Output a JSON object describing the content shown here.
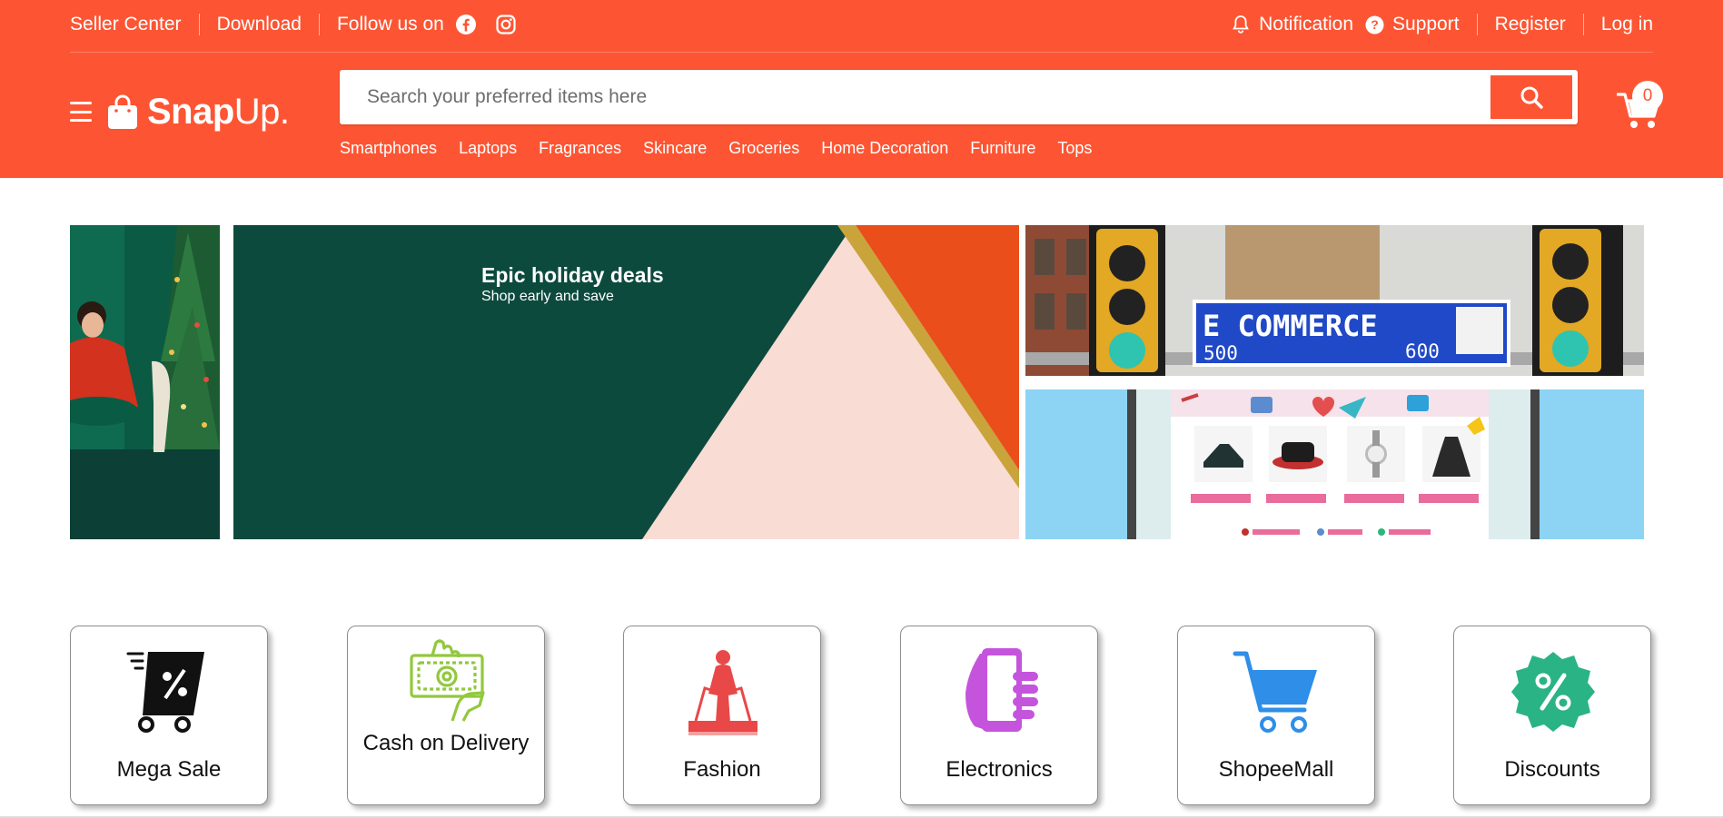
{
  "colors": {
    "brand": "#fd5533",
    "white": "#ffffff"
  },
  "topbar": {
    "seller_center": "Seller Center",
    "download": "Download",
    "follow_us": "Follow us on",
    "social_icons": [
      "facebook-icon",
      "instagram-icon"
    ],
    "notification": "Notification",
    "support": "Support",
    "register": "Register",
    "login": "Log in"
  },
  "brand": {
    "logo_bold": "Snap",
    "logo_thin": "Up."
  },
  "search": {
    "placeholder": "Search your preferred items here",
    "value": ""
  },
  "categories": [
    "Smartphones",
    "Laptops",
    "Fragrances",
    "Skincare",
    "Groceries",
    "Home Decoration",
    "Furniture",
    "Tops"
  ],
  "cart": {
    "count": "0"
  },
  "promo": {
    "title": "Epic holiday deals",
    "subtitle": "Shop early and save",
    "sign_text": "E COMMERCE",
    "sign_left_number": "500",
    "sign_right_number": "600"
  },
  "features": [
    {
      "label": "Mega Sale",
      "icon": "mega-sale-icon"
    },
    {
      "label": "Cash on Delivery",
      "icon": "cash-on-delivery-icon"
    },
    {
      "label": "Fashion",
      "icon": "fashion-icon"
    },
    {
      "label": "Electronics",
      "icon": "electronics-icon"
    },
    {
      "label": "ShopeeMall",
      "icon": "shopping-cart-icon"
    },
    {
      "label": "Discounts",
      "icon": "discount-badge-icon"
    }
  ]
}
